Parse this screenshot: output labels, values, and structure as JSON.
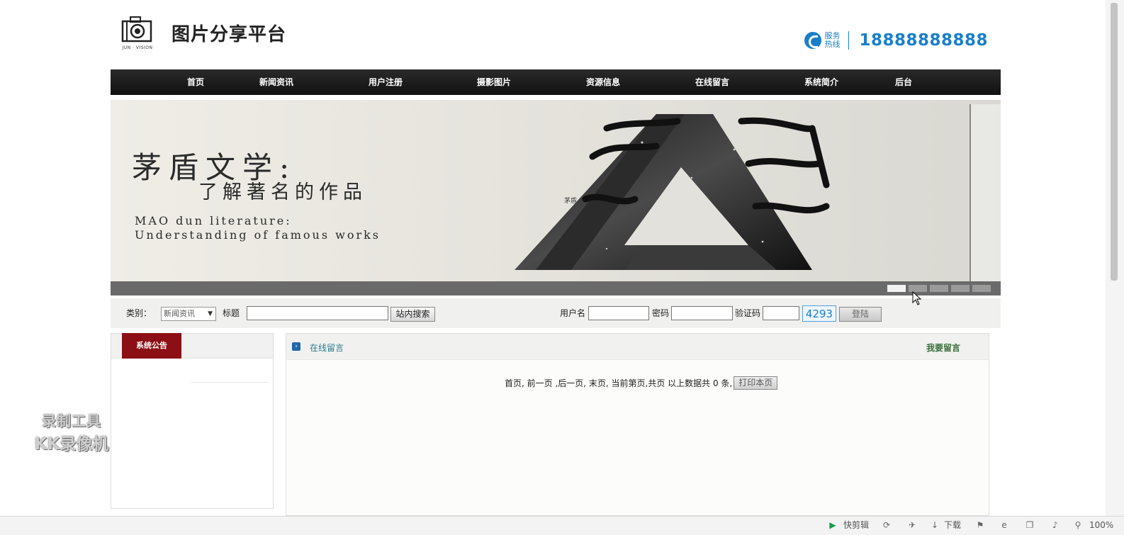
{
  "header": {
    "logo_caption": "JUN · VISION",
    "site_title": "图片分享平台",
    "hotline_label": "服务热线",
    "hotline_number": "18888888888"
  },
  "nav": {
    "items": [
      "首页",
      "新闻资讯",
      "用户注册",
      "摄影图片",
      "资源信息",
      "在线留言",
      "系统简介",
      "后台"
    ]
  },
  "banner": {
    "title_cn": "茅盾文学:",
    "subtitle_cn": "了解著名的作品",
    "title_en_line1": "MAO dun literature:",
    "title_en_line2": "Understanding of famous works",
    "art_text": "茅盾",
    "slide_count": 5,
    "active_slide": 1
  },
  "search": {
    "category_label": "类别：",
    "category_value": "新闻资讯",
    "title_label": "标题",
    "title_value": "",
    "search_button": "站内搜索"
  },
  "login": {
    "username_label": "用户名",
    "username_value": "",
    "password_label": "密码",
    "password_value": "",
    "captcha_label": "验证码",
    "captcha_value": "",
    "captcha_code": "4293",
    "login_button": "登陆"
  },
  "sidebar": {
    "tab_label": "系统公告"
  },
  "main": {
    "panel_title": "在线留言",
    "panel_action": "我要留言",
    "pager_text": "首页, 前一页 ,后一页, 末页, 当前第页,共页 以上数据共 0 条,",
    "print_button": "打印本页"
  },
  "watermark": {
    "line1": "录制工具",
    "line2": "KK录像机"
  },
  "statusbar": {
    "kuaijianji": "快剪辑",
    "download": "下载",
    "zoom": "100%"
  },
  "colors": {
    "accent_blue": "#1a7fc9",
    "nav_bg": "#1a1a1a",
    "sidebar_tab": "#8b0f14"
  }
}
